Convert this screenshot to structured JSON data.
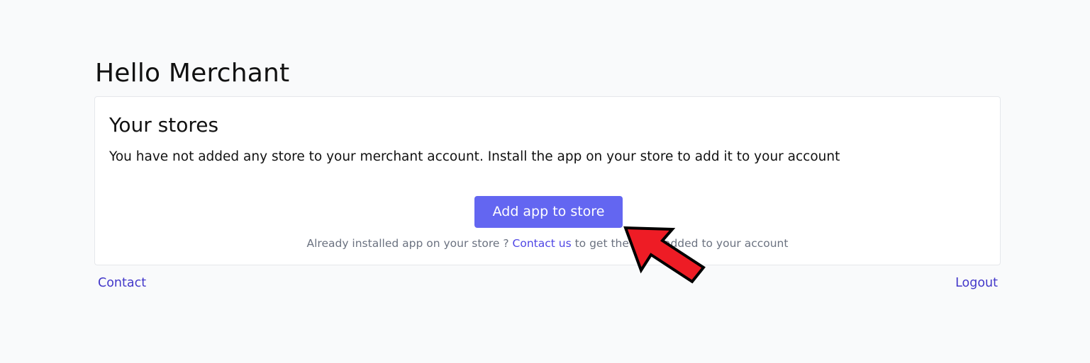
{
  "header": {
    "greeting": "Hello Merchant"
  },
  "stores_card": {
    "title": "Your stores",
    "description": "You have not added any store to your merchant account. Install the app on your store to add it to your account",
    "add_button_label": "Add app to store",
    "helper_prefix": "Already installed app on your store ? ",
    "helper_link": "Contact us",
    "helper_suffix": " to get the store added to your account"
  },
  "footer": {
    "contact_label": "Contact",
    "logout_label": "Logout"
  },
  "annotation": {
    "icon": "red-arrow-pointer",
    "color": "#ee1c25"
  },
  "colors": {
    "primary": "#6366f1",
    "link": "#4f46e5",
    "background": "#f9fafb"
  }
}
